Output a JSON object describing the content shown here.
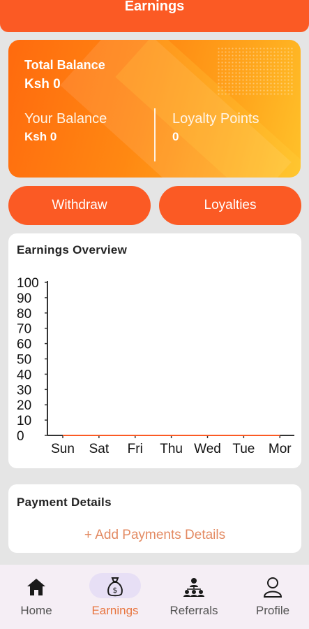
{
  "header": {
    "title": "Earnings"
  },
  "balance_card": {
    "total_label": "Total Balance",
    "total_value": "Ksh 0",
    "your_balance_label": "Your Balance",
    "your_balance_value": "Ksh 0",
    "loyalty_label": "Loyalty Points",
    "loyalty_value": "0"
  },
  "actions": {
    "withdraw": "Withdraw",
    "loyalties": "Loyalties"
  },
  "overview": {
    "title": "Earnings Overview",
    "chart_data": {
      "type": "line",
      "categories": [
        "Sun",
        "Sat",
        "Fri",
        "Thu",
        "Wed",
        "Tue",
        "Mor"
      ],
      "values": [
        0,
        0,
        0,
        0,
        0,
        0,
        0
      ],
      "yticks": [
        "100",
        "90",
        "80",
        "70",
        "60",
        "50",
        "40",
        "30",
        "20",
        "10",
        "0"
      ],
      "ylim": [
        0,
        100
      ],
      "grid": false
    }
  },
  "payment": {
    "title": "Payment Details",
    "add_label": "+ Add Payments Details"
  },
  "nav": {
    "items": [
      {
        "label": "Home",
        "icon": "home-icon"
      },
      {
        "label": "Earnings",
        "icon": "money-bag-icon"
      },
      {
        "label": "Referrals",
        "icon": "referrals-icon"
      },
      {
        "label": "Profile",
        "icon": "profile-icon"
      }
    ],
    "active_color": "#e8753f"
  },
  "colors": {
    "primary": "#fb5a24",
    "card_orange": "#ff8812"
  }
}
